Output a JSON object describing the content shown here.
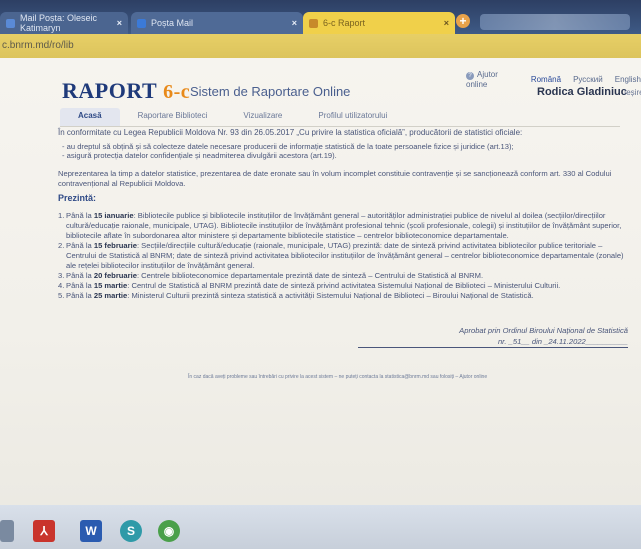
{
  "browser": {
    "tabs": [
      {
        "label": "Mail Poșta: Oleseic Katimaryn",
        "close": "×"
      },
      {
        "label": "Poșta Mail",
        "close": "×"
      },
      {
        "label": "6-c Raport",
        "close": "×"
      }
    ],
    "new_tab": "+",
    "address": "c.bnrm.md/ro/lib"
  },
  "header": {
    "logo_main": "RAPORT",
    "logo_version": "6-c",
    "subtitle": "Sistem de Raportare Online",
    "help_link": "Ajutor online",
    "help_icon": "?",
    "languages": [
      "Română",
      "Pусский",
      "English"
    ],
    "user_name": "Rodica Gladiniuc",
    "logout": "Ieșire"
  },
  "nav": {
    "tabs": [
      "Acasă",
      "Raportare Biblioteci",
      "Vizualizare",
      "Profilul utilizatorului"
    ]
  },
  "content": {
    "intro": "În conformitate cu Legea Republicii Moldova Nr. 93 din 26.05.2017 „Cu privire la statistica oficială”, producătorii de statistici oficiale:",
    "bullets": [
      "- au dreptul să obțină și să colecteze datele necesare producerii de informație statistică de la toate persoanele fizice și juridice (art.13);",
      "- asigură protecția datelor confidențiale și neadmiterea divulgării acestora (art.19)."
    ],
    "warning": "Neprezentarea la timp a datelor statistice, prezentarea de date eronate sau în volum incomplet constituie contravenție și se sancționează conform art. 330 al Codului contravențional al Republicii Moldova.",
    "heading": "Prezintă:",
    "items": [
      {
        "num": "1.",
        "prefix": "Până la ",
        "date": "15 ianuarie",
        "text": ": Bibliotecile publice și bibliotecile instituțiilor de învățământ general – autorităților administrației publice de nivelul al doilea (secțiilor/direcțiilor cultură/educație raionale, municipale, UTAG). Bibliotecile instituțiilor de învățământ profesional tehnic (școli profesionale, colegii) și instituțiilor de învățământ superior, bibliotecile aflate în subordonarea altor ministere și departamente bibliotecile statistice – centrelor biblioteconomice departamentale."
      },
      {
        "num": "2.",
        "prefix": "Până la ",
        "date": "15 februarie",
        "text": ": Secțiile/direcțiile cultură/educație (raionale, municipale, UTAG) prezintă: date de sinteză privind activitatea bibliotecilor publice teritoriale – Centrului de Statistică al BNRM; date de sinteză privind activitatea bibliotecilor instituțiilor de învățământ general – centrelor biblioteconomice departamentale (zonale) ale rețelei bibliotecilor instituțiilor de învățământ general."
      },
      {
        "num": "3.",
        "prefix": "Până la ",
        "date": "20 februarie",
        "text": ": Centrele biblioteconomice departamentale prezintă date de sinteză – Centrului de Statistică al BNRM."
      },
      {
        "num": "4.",
        "prefix": "Până la ",
        "date": "15 martie",
        "text": ": Centrul de Statistică al BNRM prezintă date de sinteză privind activitatea Sistemului Național de Biblioteci – Ministerului Culturii."
      },
      {
        "num": "5.",
        "prefix": "Până la ",
        "date": "25 martie",
        "text": ": Ministerul Culturii prezintă sinteza statistică a activității Sistemului Național de Biblioteci – Biroului Național de Statistică."
      }
    ],
    "approved_line1": "Aprobat prin Ordinul Biroului Național de Statistică",
    "approved_line2": "nr. _51__ din _24.11.2022__________",
    "footer": "În caz dacă aveți probleme sau întrebări cu privire la acest sistem – ne puteți contacta la statistica@bnrm.md sau folosiți – Ajutor online"
  },
  "taskbar": {
    "icons": [
      "windows-icon",
      "pdf-icon",
      "word-icon",
      "skype-icon",
      "chrome-icon"
    ],
    "glyphs": [
      "",
      "⅄",
      "W",
      "S",
      "◉"
    ]
  }
}
